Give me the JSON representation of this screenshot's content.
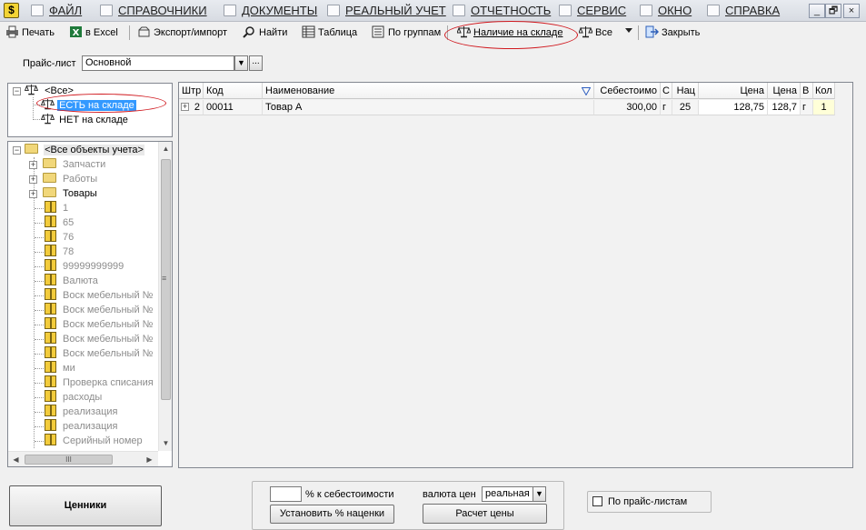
{
  "menu": {
    "items": [
      {
        "id": "file",
        "label": "ФАЙЛ"
      },
      {
        "id": "references",
        "label": "СПРАВОЧНИКИ"
      },
      {
        "id": "documents",
        "label": "ДОКУМЕНТЫ"
      },
      {
        "id": "real_accounting",
        "label": "РЕАЛЬНЫЙ УЧЕТ"
      },
      {
        "id": "reports",
        "label": "ОТЧЕТНОСТЬ"
      },
      {
        "id": "service",
        "label": "СЕРВИС"
      },
      {
        "id": "window",
        "label": "ОКНО"
      },
      {
        "id": "help",
        "label": "СПРАВКА"
      }
    ],
    "window_buttons": {
      "minimize": "_",
      "restore": "🗗",
      "close": "×"
    }
  },
  "toolbar": {
    "print": "Печать",
    "excel": "в Excel",
    "export_import": "Экспорт/импорт",
    "find": "Найти",
    "table": "Таблица",
    "by_groups": "По группам",
    "in_stock": "Наличие на складе",
    "all": "Все",
    "close": "Закрыть"
  },
  "price_list": {
    "label": "Прайс-лист",
    "value": "Основной",
    "more_button": "..."
  },
  "stock_tree": {
    "root": "<Все>",
    "items": [
      "ЕСТЬ на складе",
      "НЕТ на складе"
    ],
    "selected_index": 0
  },
  "objects_tree": {
    "root": "<Все объекты учета>",
    "folders": [
      "Запчасти",
      "Работы",
      "Товары"
    ],
    "items": [
      "1",
      "65",
      "76",
      "78",
      "99999999999",
      "Валюта",
      "Воск мебельный №",
      "Воск мебельный №",
      "Воск мебельный №",
      "Воск мебельный №",
      "Воск мебельный №",
      "ми",
      "Проверка списания",
      "расходы",
      "реализация",
      "реализация",
      "Серийный номер"
    ],
    "hscroll_thumb": "III"
  },
  "grid": {
    "columns": [
      "Штр",
      "Код",
      "Наименование",
      "Себестоимо",
      "С",
      "Нац",
      "Цена",
      "Цена",
      "В",
      "Кол"
    ],
    "rows": [
      {
        "expand": "+",
        "shtr": "2",
        "code": "00011",
        "name": "Товар А",
        "cost": "300,00",
        "c": "г",
        "markup": "25",
        "price1": "128,75",
        "price2": "128,7",
        "v": "г",
        "qty": "1"
      }
    ]
  },
  "bottom": {
    "price_tags_button": "Ценники",
    "percent_input": "",
    "percent_label": "% к себестоимости",
    "set_markup_button": "Установить % наценки",
    "currency_label": "валюта цен",
    "currency_value": "реальная",
    "calc_button": "Расчет цены",
    "by_price_lists": "По прайс-листам",
    "by_price_lists_checked": false
  },
  "colors": {
    "highlight_ellipse": "#d0181e",
    "selection": "#3399ff",
    "filter_icon": "#3060c0"
  }
}
